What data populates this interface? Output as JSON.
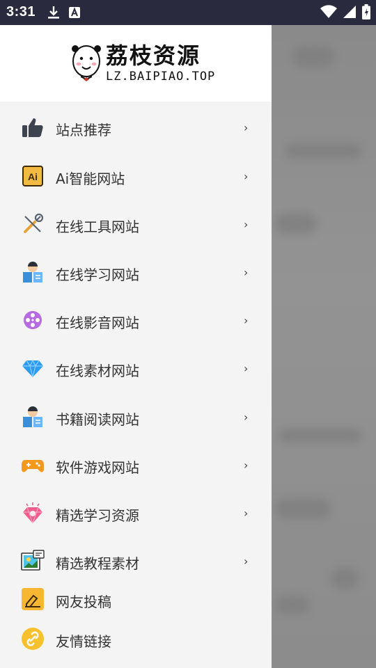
{
  "status_bar": {
    "time": "3:31",
    "left_icons": [
      "download-icon",
      "a-notification-icon"
    ],
    "right_icons": [
      "wifi-icon",
      "cell-signal-icon",
      "battery-icon"
    ]
  },
  "header": {
    "logo_title": "荔枝资源",
    "logo_subtitle": "LZ.BAIPIAO.TOP"
  },
  "menu": {
    "items": [
      {
        "label": "站点推荐",
        "icon": "thumbs-up-icon",
        "has_arrow": true
      },
      {
        "label": "Ai智能网站",
        "icon": "ai-icon",
        "has_arrow": true
      },
      {
        "label": "在线工具网站",
        "icon": "tools-icon",
        "has_arrow": true
      },
      {
        "label": "在线学习网站",
        "icon": "reading-person-icon",
        "has_arrow": true
      },
      {
        "label": "在线影音网站",
        "icon": "film-reel-icon",
        "has_arrow": true
      },
      {
        "label": "在线素材网站",
        "icon": "diamond-icon",
        "has_arrow": true
      },
      {
        "label": "书籍阅读网站",
        "icon": "reading-person-icon",
        "has_arrow": true
      },
      {
        "label": "软件游戏网站",
        "icon": "gamepad-icon",
        "has_arrow": true
      },
      {
        "label": "精选学习资源",
        "icon": "gem-badge-icon",
        "has_arrow": true
      },
      {
        "label": "精选教程素材",
        "icon": "tutorial-image-icon",
        "has_arrow": true
      },
      {
        "label": "网友投稿",
        "icon": "pen-submit-icon",
        "has_arrow": false
      },
      {
        "label": "友情链接",
        "icon": "link-icon",
        "has_arrow": false
      }
    ],
    "arrow_glyph": "›"
  },
  "colors": {
    "status_bar_bg": "#2a2a3e",
    "drawer_bg": "#f4f4f4",
    "header_bg": "#ffffff",
    "scrim": "#8e8e8e",
    "label_text": "#333333"
  }
}
